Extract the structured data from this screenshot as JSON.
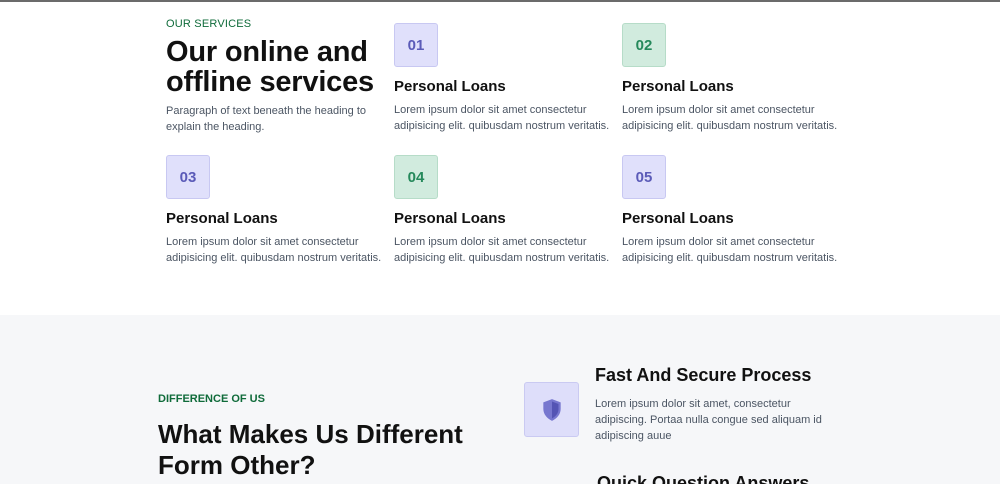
{
  "services": {
    "eyebrow": "OUR SERVICES",
    "title": "Our online and offline services",
    "paragraph": "Paragraph of text beneath the heading to explain the heading.",
    "cards": [
      {
        "number": "01",
        "color": "purple",
        "title": "Personal Loans",
        "text": "Lorem ipsum dolor sit amet consectetur adipisicing elit. quibusdam nostrum veritatis."
      },
      {
        "number": "02",
        "color": "green",
        "title": "Personal Loans",
        "text": "Lorem ipsum dolor sit amet consectetur adipisicing elit. quibusdam nostrum veritatis."
      },
      {
        "number": "03",
        "color": "purple",
        "title": "Personal Loans",
        "text": "Lorem ipsum dolor sit amet consectetur adipisicing elit. quibusdam nostrum veritatis."
      },
      {
        "number": "04",
        "color": "green",
        "title": "Personal Loans",
        "text": "Lorem ipsum dolor sit amet consectetur adipisicing elit. quibusdam nostrum veritatis."
      },
      {
        "number": "05",
        "color": "purple",
        "title": "Personal Loans",
        "text": "Lorem ipsum dolor sit amet consectetur adipisicing elit. quibusdam nostrum veritatis."
      }
    ]
  },
  "difference": {
    "eyebrow": "DIFFERENCE OF US",
    "title": "What Makes Us Different Form Other?",
    "features": [
      {
        "icon": "shield-icon",
        "title": "Fast And Secure Process",
        "text": "Lorem ipsum dolor sit amet, consectetur adipiscing. Portaa nulla congue sed aliquam id adipiscing auue"
      },
      {
        "title": "Quick Question Answers"
      }
    ]
  },
  "colors": {
    "accent_green": "#0f6b3a",
    "purple_tint": "#e0e0fb",
    "green_tint": "#d1ebde",
    "section_gray": "#f6f7f9"
  }
}
